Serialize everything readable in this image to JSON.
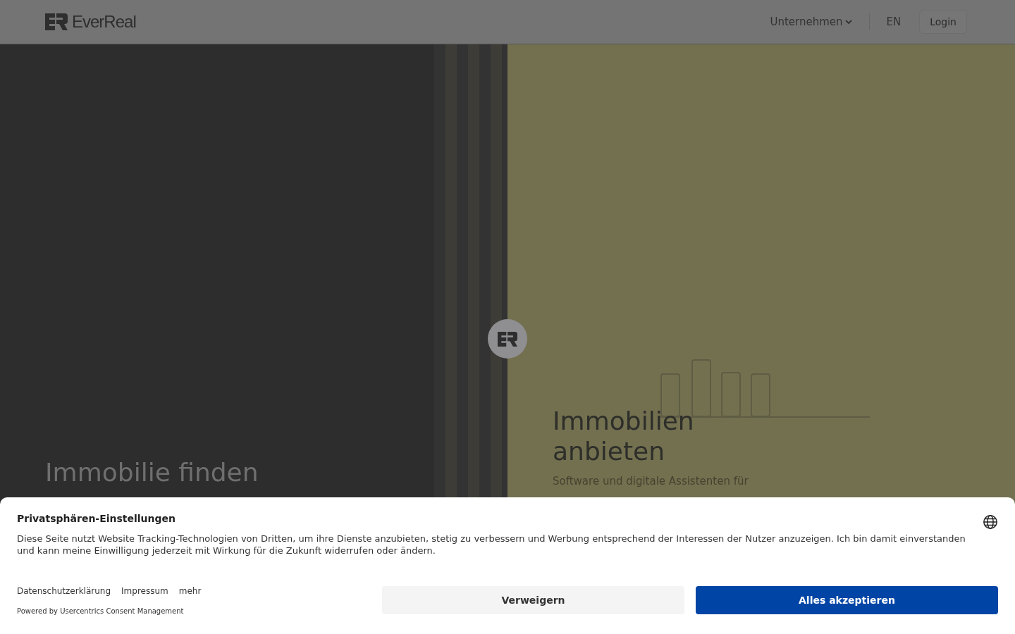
{
  "header": {
    "brand": "EverReal",
    "nav": [
      {
        "label": "Unternehmen",
        "kind": "dropdown"
      },
      {
        "label": "EN",
        "kind": "link"
      },
      {
        "label": "Login",
        "kind": "button"
      }
    ]
  },
  "panels": [
    {
      "title": "Immobilie finden",
      "kind": "dark"
    },
    {
      "title": "Immobilien anbieten",
      "subtitle": "Software und digitale Assistenten für",
      "kind": "light"
    }
  ],
  "consent": {
    "title": "Privatsphären-Einstellungen",
    "text": "Diese Seite nutzt Website Tracking-Technologien von Dritten, um ihre Dienste anzubieten, stetig zu verbessern und Werbung entsprechend der Interessen der Nutzer anzuzeigen. Ich bin damit einverstanden und kann meine Einwilligung jederzeit mit Wirkung für die Zukunft widerrufen oder ändern.",
    "links": [
      "Datenschutzerklärung",
      "Impressum",
      "mehr"
    ],
    "powered_by": "Powered by Usercentrics Consent Management",
    "buttons": [
      {
        "label": "Verweigern",
        "kind": "secondary"
      },
      {
        "label": "Alles akzeptieren",
        "kind": "primary"
      }
    ]
  }
}
